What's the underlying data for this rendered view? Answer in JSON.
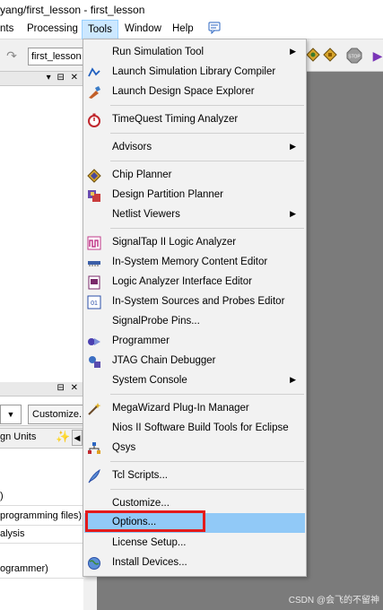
{
  "window": {
    "title": "yang/first_lesson - first_lesson"
  },
  "menubar": {
    "items": [
      {
        "label": "nts"
      },
      {
        "label": "Processing"
      },
      {
        "label": "Tools"
      },
      {
        "label": "Window"
      },
      {
        "label": "Help"
      }
    ]
  },
  "toolbar": {
    "project_combo": "first_lesson"
  },
  "left_panel": {
    "tab_label": "gn Units",
    "customize_button": "Customize...",
    "lines": [
      ")",
      " programming files)",
      "alysis",
      "ogrammer)"
    ]
  },
  "tools_menu": {
    "items": [
      {
        "label": "Run Simulation Tool",
        "icon": "none",
        "submenu": true
      },
      {
        "label": "Launch Simulation Library Compiler",
        "icon": "sim-library-icon",
        "submenu": false
      },
      {
        "label": "Launch Design Space Explorer",
        "icon": "design-space-icon",
        "submenu": false
      },
      {
        "label": "TimeQuest Timing Analyzer",
        "icon": "stopwatch-icon",
        "submenu": false
      },
      {
        "label": "Advisors",
        "icon": "none",
        "submenu": true
      },
      {
        "label": "Chip Planner",
        "icon": "chip-planner-icon",
        "submenu": false
      },
      {
        "label": "Design Partition Planner",
        "icon": "partition-planner-icon",
        "submenu": false
      },
      {
        "label": "Netlist Viewers",
        "icon": "none",
        "submenu": true
      },
      {
        "label": "SignalTap II Logic Analyzer",
        "icon": "signaltap-icon",
        "submenu": false
      },
      {
        "label": "In-System Memory Content Editor",
        "icon": "memory-editor-icon",
        "submenu": false
      },
      {
        "label": "Logic Analyzer Interface Editor",
        "icon": "logic-analyzer-icon",
        "submenu": false
      },
      {
        "label": "In-System Sources and Probes Editor",
        "icon": "sources-probes-icon",
        "submenu": false
      },
      {
        "label": "SignalProbe Pins...",
        "icon": "none",
        "submenu": false
      },
      {
        "label": "Programmer",
        "icon": "programmer-icon",
        "submenu": false
      },
      {
        "label": "JTAG Chain Debugger",
        "icon": "jtag-icon",
        "submenu": false
      },
      {
        "label": "System Console",
        "icon": "none",
        "submenu": true
      },
      {
        "label": "MegaWizard Plug-In Manager",
        "icon": "wand-icon",
        "submenu": false
      },
      {
        "label": "Nios II Software Build Tools for Eclipse",
        "icon": "none",
        "submenu": false
      },
      {
        "label": "Qsys",
        "icon": "qsys-icon",
        "submenu": false
      },
      {
        "label": "Tcl Scripts...",
        "icon": "tcl-feather-icon",
        "submenu": false
      },
      {
        "label": "Customize...",
        "icon": "none",
        "submenu": false
      },
      {
        "label": "Options...",
        "icon": "none",
        "submenu": false,
        "highlighted": true
      },
      {
        "label": "License Setup...",
        "icon": "none",
        "submenu": false
      },
      {
        "label": "Install Devices...",
        "icon": "globe-icon",
        "submenu": false
      }
    ]
  },
  "watermark": "CSDN @会飞的不留神",
  "colors": {
    "highlight": "#91c9f7",
    "callout_red": "#e41b1b",
    "workspace": "#7b7b7b"
  }
}
